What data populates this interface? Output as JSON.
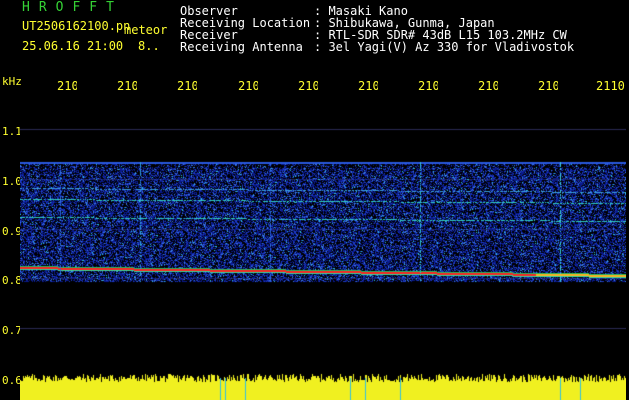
{
  "header": {
    "logo": "HROFFT",
    "filename": "UT2506162100.pn",
    "meteor_label": "meteor",
    "datetime": "25.06.16 21:00",
    "count": "8.."
  },
  "meta": [
    {
      "label": "Observer",
      "value": ": Masaki Kano"
    },
    {
      "label": "Receiving Location",
      "value": ": Shibukawa, Gunma, Japan"
    },
    {
      "label": "Receiver",
      "value": ": RTL-SDR SDR# 43dB L15 103.2MHz CW"
    },
    {
      "label": "Receiving Antenna",
      "value": ": 3el Yagi(V) Az 330 for Vladivostok"
    }
  ],
  "axes": {
    "y_unit": "kHz",
    "y_ticks": [
      "1.1",
      "1.0",
      "0.9",
      "0.8",
      "0.7",
      "0.6"
    ],
    "x_ticks": [
      "210",
      "210",
      "210",
      "210",
      "210",
      "210",
      "210",
      "210",
      "210",
      "2110"
    ]
  },
  "colors": {
    "background": "#000000",
    "text_yellow": "#ffff30",
    "logo_green": "#35d235",
    "noise_blue": "#1e3cc8",
    "signal_cyan": "#30e0e0",
    "signal_red": "#ff2020"
  }
}
